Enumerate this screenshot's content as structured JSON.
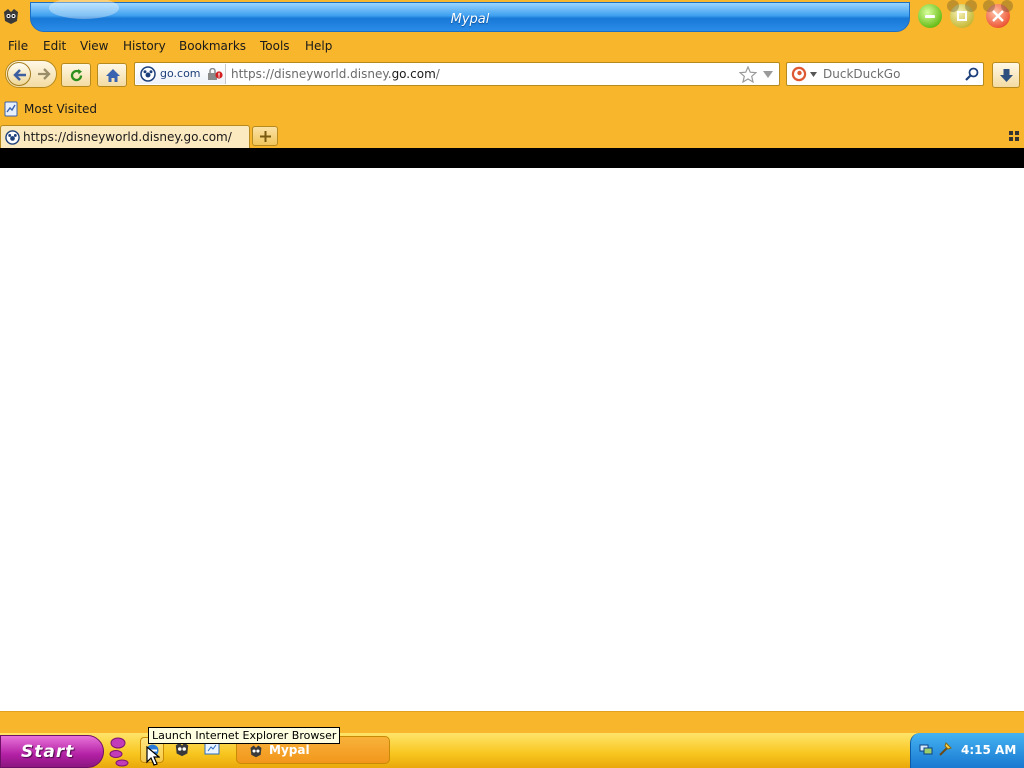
{
  "window": {
    "title": "Mypal"
  },
  "menu": [
    "File",
    "Edit",
    "View",
    "History",
    "Bookmarks",
    "Tools",
    "Help"
  ],
  "navbar": {
    "identity_label": "go.com",
    "url_prefix": "https://disneyworld.disney.",
    "url_domain": "go.com",
    "url_suffix": "/",
    "search_placeholder": "DuckDuckGo"
  },
  "bookmarks": {
    "most_visited": "Most Visited"
  },
  "tabs": [
    {
      "label": "https://disneyworld.disney.go.com/"
    }
  ],
  "taskbar": {
    "start_label": "Start",
    "tasks": [
      {
        "label": "Mypal"
      }
    ],
    "clock": "4:15 AM",
    "tooltip": "Launch Internet Explorer Browser"
  },
  "colors": {
    "chrome": "#f7b62c",
    "title_blue": "#2b8ce8",
    "start_purple": "#b320a4",
    "tray_blue": "#1978d0"
  }
}
